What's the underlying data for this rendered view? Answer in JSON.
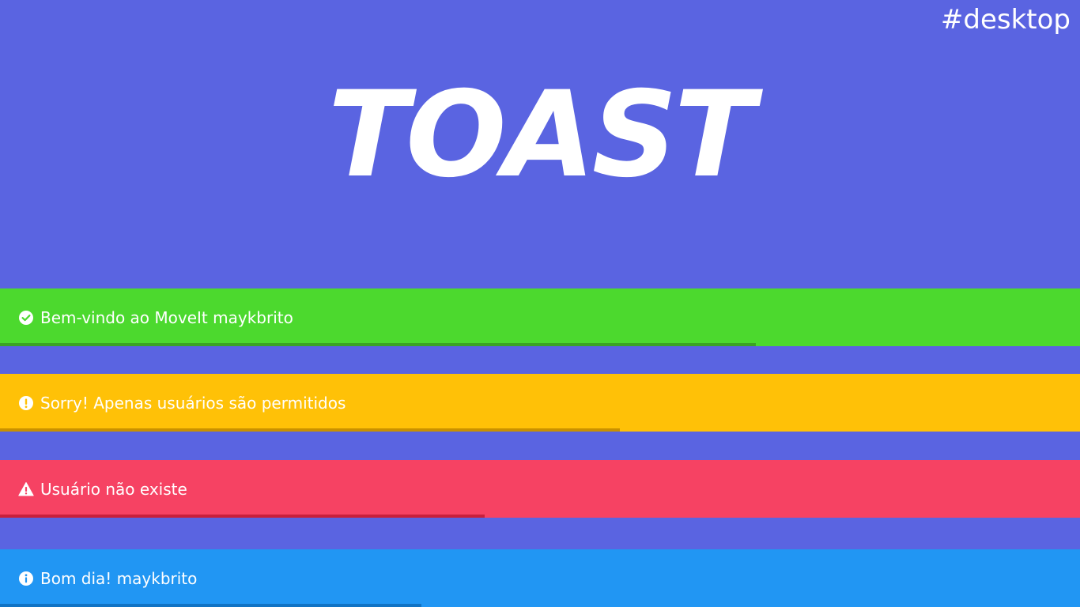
{
  "header": {
    "tag": "#desktop",
    "title": "TOAST"
  },
  "toasts": [
    {
      "type": "success",
      "icon": "check-circle-icon",
      "message": "Bem-vindo ao MoveIt maykbrito",
      "progress": 0.7,
      "color": "#4cd92e"
    },
    {
      "type": "warning",
      "icon": "exclamation-circle-icon",
      "message": "Sorry! Apenas usuários são permitidos",
      "progress": 0.574,
      "color": "#ffc107"
    },
    {
      "type": "error",
      "icon": "warning-triangle-icon",
      "message": "Usuário não existe",
      "progress": 0.449,
      "color": "#f64263"
    },
    {
      "type": "info",
      "icon": "info-circle-icon",
      "message": "Bom dia! maykbrito",
      "progress": 0.39,
      "color": "#2196f3"
    }
  ],
  "colors": {
    "background": "#5a64e1",
    "text": "#ffffff"
  }
}
